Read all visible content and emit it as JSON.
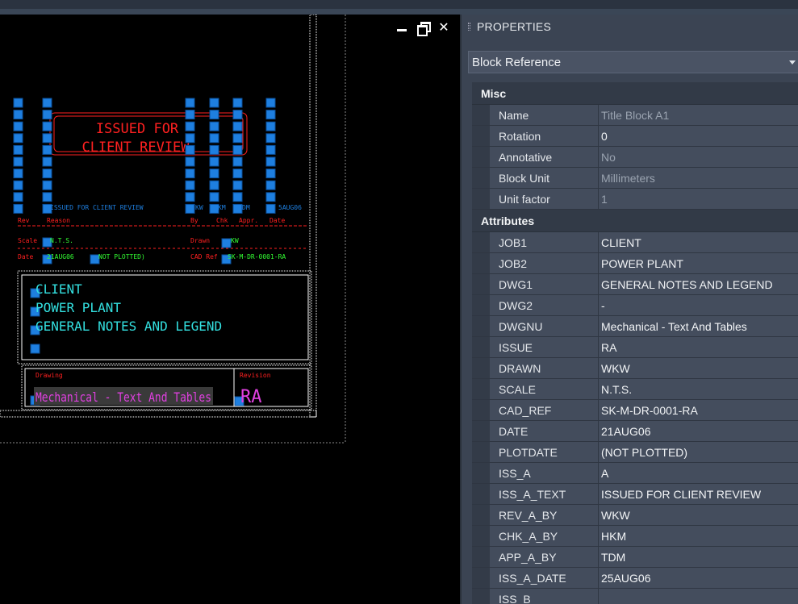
{
  "viewport": {
    "controls": {
      "minimize": "minimize",
      "restore": "restore",
      "close": "✕"
    },
    "drawing": {
      "stamp_line1": "ISSUED FOR",
      "stamp_line2": "CLIENT REVIEW",
      "rev_row": "ISSUED FOR CLIENT REVIEW",
      "rev_cols": [
        "Rev",
        "Reason",
        "By",
        "Chk",
        "Appr.",
        "Date"
      ],
      "rev_by": "KW",
      "rev_chk": "KM",
      "rev_app": "DM",
      "rev_date": "5AUG06",
      "scale_label": "Scale",
      "scale_value": "N.T.S.",
      "drawn_label": "Drawn",
      "drawn_value": "KW",
      "date_label": "Date",
      "date_value": "21AUG06",
      "plot_value": "NOT PLOTTED)",
      "cadref_label": "CAD Ref",
      "cadref_value": "SK-M-DR-0001-RA",
      "job1": "CLIENT",
      "job2": "POWER PLANT",
      "dwg1": "GENERAL NOTES AND LEGEND",
      "drawing_label": "Drawing",
      "drawing_value": "Mechanical - Text And Tables",
      "revision_label": "Revision",
      "revision_value": "RA",
      "colors": {
        "red": "#ff2020",
        "blue": "#1e7fe0",
        "green": "#33ff33",
        "cyan": "#33e0e0",
        "magenta": "#e040e0",
        "white": "#ffffff"
      }
    }
  },
  "properties": {
    "title": "PROPERTIES",
    "selector": "Block Reference",
    "misc": {
      "header": "Misc",
      "rows": [
        {
          "key": "Name",
          "value": "Title Block A1",
          "readonly": true
        },
        {
          "key": "Rotation",
          "value": "0",
          "readonly": false
        },
        {
          "key": "Annotative",
          "value": "No",
          "readonly": true
        },
        {
          "key": "Block Unit",
          "value": "Millimeters",
          "readonly": true
        },
        {
          "key": "Unit factor",
          "value": "1",
          "readonly": true
        }
      ]
    },
    "attributes": {
      "header": "Attributes",
      "rows": [
        {
          "key": "JOB1",
          "value": "CLIENT"
        },
        {
          "key": "JOB2",
          "value": "POWER PLANT"
        },
        {
          "key": "DWG1",
          "value": "GENERAL NOTES AND LEGEND"
        },
        {
          "key": "DWG2",
          "value": "-"
        },
        {
          "key": "DWGNU",
          "value": "Mechanical - Text And Tables"
        },
        {
          "key": "ISSUE",
          "value": "RA"
        },
        {
          "key": "DRAWN",
          "value": "WKW"
        },
        {
          "key": "SCALE",
          "value": "N.T.S."
        },
        {
          "key": "CAD_REF",
          "value": "SK-M-DR-0001-RA"
        },
        {
          "key": "DATE",
          "value": "21AUG06"
        },
        {
          "key": "PLOTDATE",
          "value": "(NOT PLOTTED)"
        },
        {
          "key": "ISS_A",
          "value": "A"
        },
        {
          "key": "ISS_A_TEXT",
          "value": "ISSUED FOR CLIENT REVIEW"
        },
        {
          "key": "REV_A_BY",
          "value": "WKW"
        },
        {
          "key": "CHK_A_BY",
          "value": "HKM"
        },
        {
          "key": "APP_A_BY",
          "value": "TDM"
        },
        {
          "key": "ISS_A_DATE",
          "value": "25AUG06"
        },
        {
          "key": "ISS_B",
          "value": ""
        }
      ]
    }
  }
}
